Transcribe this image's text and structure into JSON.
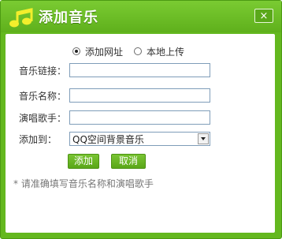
{
  "window": {
    "title": "添加音乐",
    "close_label": "×"
  },
  "source": {
    "options": [
      {
        "label": "添加网址",
        "selected": true
      },
      {
        "label": "本地上传",
        "selected": false
      }
    ]
  },
  "form": {
    "link_label": "音乐链接：",
    "link_value": "",
    "name_label": "音乐名称：",
    "name_value": "",
    "singer_label": "演唱歌手：",
    "singer_value": "",
    "target_label": "添加到：",
    "target_selected": "QQ空间背景音乐"
  },
  "buttons": {
    "add_label": "添加",
    "cancel_label": "取消"
  },
  "hint": "* 请准确填写音乐名称和演唱歌手",
  "colors": {
    "accent": "#64b81f",
    "border": "#4c9a12"
  },
  "icons": {
    "logo": "music-note-icon",
    "close": "close-icon"
  }
}
